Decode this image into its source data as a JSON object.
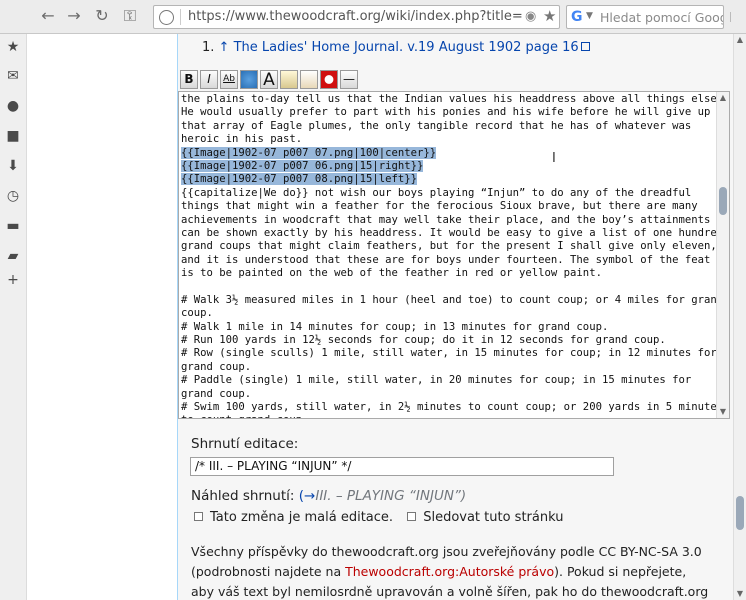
{
  "browser": {
    "url": "https://www.thewoodcraft.org/wiki/index.php?title=Ladie",
    "search_placeholder": "Hledat pomocí Googl",
    "search_engine_letter": "G"
  },
  "reference": {
    "number": "1.",
    "arrow": "↑",
    "link_text": "The Ladies' Home Journal. v.19 August 1902 page 16"
  },
  "edit_toolbar": {
    "bold": "B",
    "italic": "I",
    "link": "Ab",
    "headline": "A"
  },
  "editor": {
    "lines": [
      "the plains to-day tell us that the Indian values his headdress above all things else.",
      "He would usually prefer to part with his ponies and his wife before he will give up",
      "that array of Eagle plumes, the only tangible record that he has of whatever was",
      "heroic in his past.",
      "{{Image|1902-07 p007 07.png|100|center}}",
      "{{Image|1902-07 p007 06.png|15|right}}",
      "{{Image|1902-07 p007 08.png|15|left}}",
      "{{capitalize|We do}} not wish our boys playing “Injun” to do any of the dreadful",
      "things that might win a feather for the ferocious Sioux brave, but there are many",
      "achievements in woodcraft that may well take their place, and the boy’s attainments",
      "can be shown exactly by his headdress. It would be easy to give a list of one hundred",
      "grand coups that might claim feathers, but for the present I shall give only eleven,",
      "and it is understood that these are for boys under fourteen. The symbol of the feat",
      "is to be painted on the web of the feather in red or yellow paint.",
      "",
      "# Walk 3½ measured miles in 1 hour (heel and toe) to count coup; or 4 miles for grand",
      "coup.",
      "# Walk 1 mile in 14 minutes for coup; in 13 minutes for grand coup.",
      "# Run 100 yards in 12½ seconds for coup; do it in 12 seconds for grand coup.",
      "# Row (single sculls) 1 mile, still water, in 15 minutes for coup; in 12 minutes for",
      "grand coup.",
      "# Paddle (single) 1 mile, still water, in 20 minutes for coup; in 15 minutes for",
      "grand coup.",
      "# Swim 100 yards, still water, in 2½ minutes to count coup; or 200 yards in 5 minutes",
      "to count grand coup."
    ],
    "selected_lines": [
      4,
      5,
      6
    ]
  },
  "summary": {
    "label": "Shrnutí editace:",
    "value": "/* III. – PLAYING “INJUN” */",
    "preview_label": "Náhled shrnutí:",
    "preview_arrow": "(→",
    "preview_text": "III. – PLAYING “INJUN”)",
    "minor_edit_label": "Tato změna je malá editace.",
    "watch_label": "Sledovat tuto stránku"
  },
  "notice": {
    "part1": "Všechny příspěvky do thewoodcraft.org jsou zveřejňovány podle CC BY-NC-SA 3.0 (podrobnosti najdete na ",
    "link": "Thewoodcraft.org:Autorské právo",
    "part2": "). Pokud si nepřejete, aby váš text byl nemilosrdně upravován a volně šířen, pak ho do thewoodcraft.org neukládejte."
  },
  "colors": {
    "selection": "#97b7da",
    "link": "#0645ad",
    "red_link": "#ba0000"
  }
}
